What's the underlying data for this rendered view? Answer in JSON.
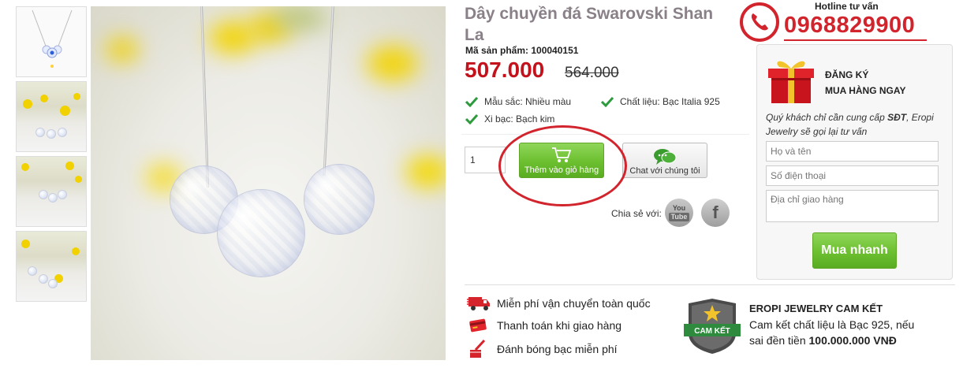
{
  "product": {
    "title": "Dây chuyền đá Swarovski Shan La",
    "sku_label": "Mã sản phẩm: 100040151",
    "price": "507.000",
    "old_price": "564.000",
    "attributes": [
      {
        "text": "Mẫu sắc: Nhiều màu"
      },
      {
        "text": "Chất liệu: Bạc Italia 925"
      },
      {
        "text": "Xi bạc: Bạch kim"
      }
    ],
    "quantity": "1",
    "add_to_cart_label": "Thêm vào giỏ hàng",
    "chat_label": "Chat với chúng tôi",
    "share_label": "Chia sẻ với:",
    "youtube_label_1": "You",
    "youtube_label_2": "Tube",
    "facebook_label": "f"
  },
  "hotline": {
    "label": "Hotline tư vấn",
    "number": "0968829900"
  },
  "register": {
    "title_line1": "ĐĂNG KÝ",
    "title_line2": "MUA HÀNG NGAY",
    "desc_pre": "Quý khách chỉ cần cung cấp ",
    "desc_bold": "SĐT",
    "desc_post": ", Eropi Jewelry sẽ gọi lại tư vấn",
    "name_placeholder": "Họ và tên",
    "phone_placeholder": "Số điện thoại",
    "address_placeholder": "Địa chỉ giao hàng",
    "buy_now_label": "Mua nhanh"
  },
  "benefits": [
    "Miễn phí vận chuyển toàn quốc",
    "Thanh toán khi giao hàng",
    "Đánh bóng bạc miễn phí"
  ],
  "guarantee": {
    "badge_text": "CAM KẾT",
    "title": "EROPI JEWELRY CAM KẾT",
    "desc": "Cam kết chất liệu là Bạc 925, nếu sai đền tiền ",
    "amount": "100.000.000 VNĐ"
  },
  "colors": {
    "price_red": "#c3121b",
    "accent_green": "#6cbf2f",
    "title_grey": "#8a8088"
  }
}
